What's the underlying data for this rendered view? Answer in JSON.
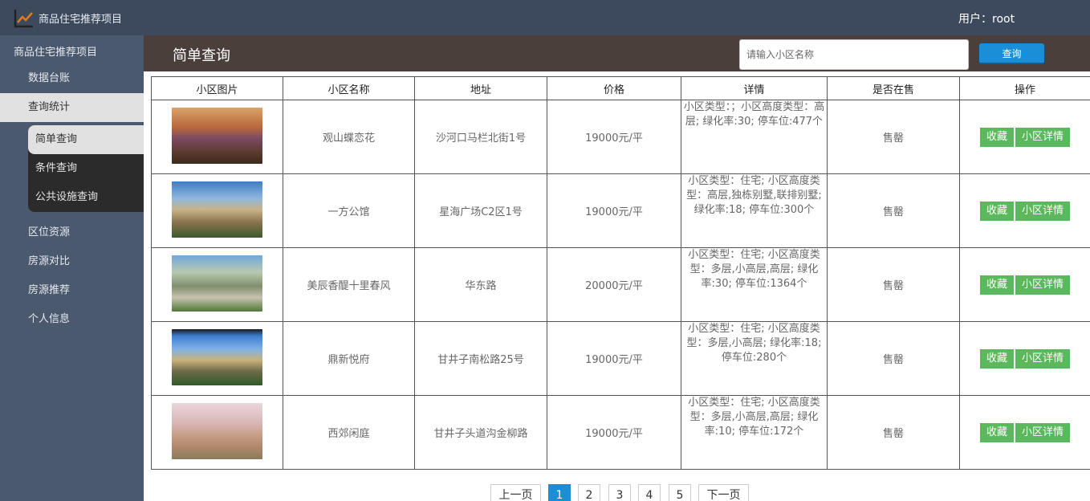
{
  "app": {
    "title": "商品住宅推荐项目",
    "user": "用户：root"
  },
  "sidebar": {
    "header": "商品住宅推荐项目",
    "items": [
      {
        "label": "数据台账"
      },
      {
        "label": "查询统计"
      },
      {
        "label": "区位资源"
      },
      {
        "label": "房源对比"
      },
      {
        "label": "房源推荐"
      },
      {
        "label": "个人信息"
      }
    ],
    "submenu": [
      {
        "label": "简单查询"
      },
      {
        "label": "条件查询"
      },
      {
        "label": "公共设施查询"
      }
    ]
  },
  "page": {
    "title": "简单查询"
  },
  "search": {
    "placeholder": "请输入小区名称",
    "button": "查询"
  },
  "table": {
    "headers": [
      "小区图片",
      "小区名称",
      "地址",
      "价格",
      "详情",
      "是否在售",
      "操作"
    ],
    "rows": [
      {
        "name": "观山蝶恋花",
        "address": "沙河口马栏北街1号",
        "price": "19000元/平",
        "detail": "小区类型：；小区高度类型：高层; 绿化率:30; 停车位:477个",
        "status": "售罄"
      },
      {
        "name": "一方公馆",
        "address": "星海广场C2区1号",
        "price": "19000元/平",
        "detail": "小区类型：住宅; 小区高度类型：高层,独栋别墅,联排别墅; 绿化率:18; 停车位:300个",
        "status": "售罄"
      },
      {
        "name": "美辰香醍十里春风",
        "address": "华东路",
        "price": "20000元/平",
        "detail": "小区类型：住宅; 小区高度类型：多层,小高层,高层; 绿化率:30; 停车位:1364个",
        "status": "售罄"
      },
      {
        "name": "鼎新悦府",
        "address": "甘井子南松路25号",
        "price": "19000元/平",
        "detail": "小区类型：住宅; 小区高度类型：多层,小高层; 绿化率:18; 停车位:280个",
        "status": "售罄"
      },
      {
        "name": "西郊闲庭",
        "address": "甘井子头道沟金柳路",
        "price": "19000元/平",
        "detail": "小区类型：住宅; 小区高度类型：多层,小高层,高层; 绿化率:10; 停车位:172个",
        "status": "售罄"
      }
    ],
    "action_fav": "收藏",
    "action_detail": "小区详情"
  },
  "pagination": {
    "prev": "上一页",
    "pages": [
      "1",
      "2",
      "3",
      "4",
      "5"
    ],
    "next": "下一页",
    "current": "1"
  },
  "colors": {
    "topbar": "#3d4a5e",
    "sidebar": "#4b596e",
    "titlebar": "#4a3f3b",
    "accent": "#1a8fd8",
    "action": "#5cb85c"
  }
}
